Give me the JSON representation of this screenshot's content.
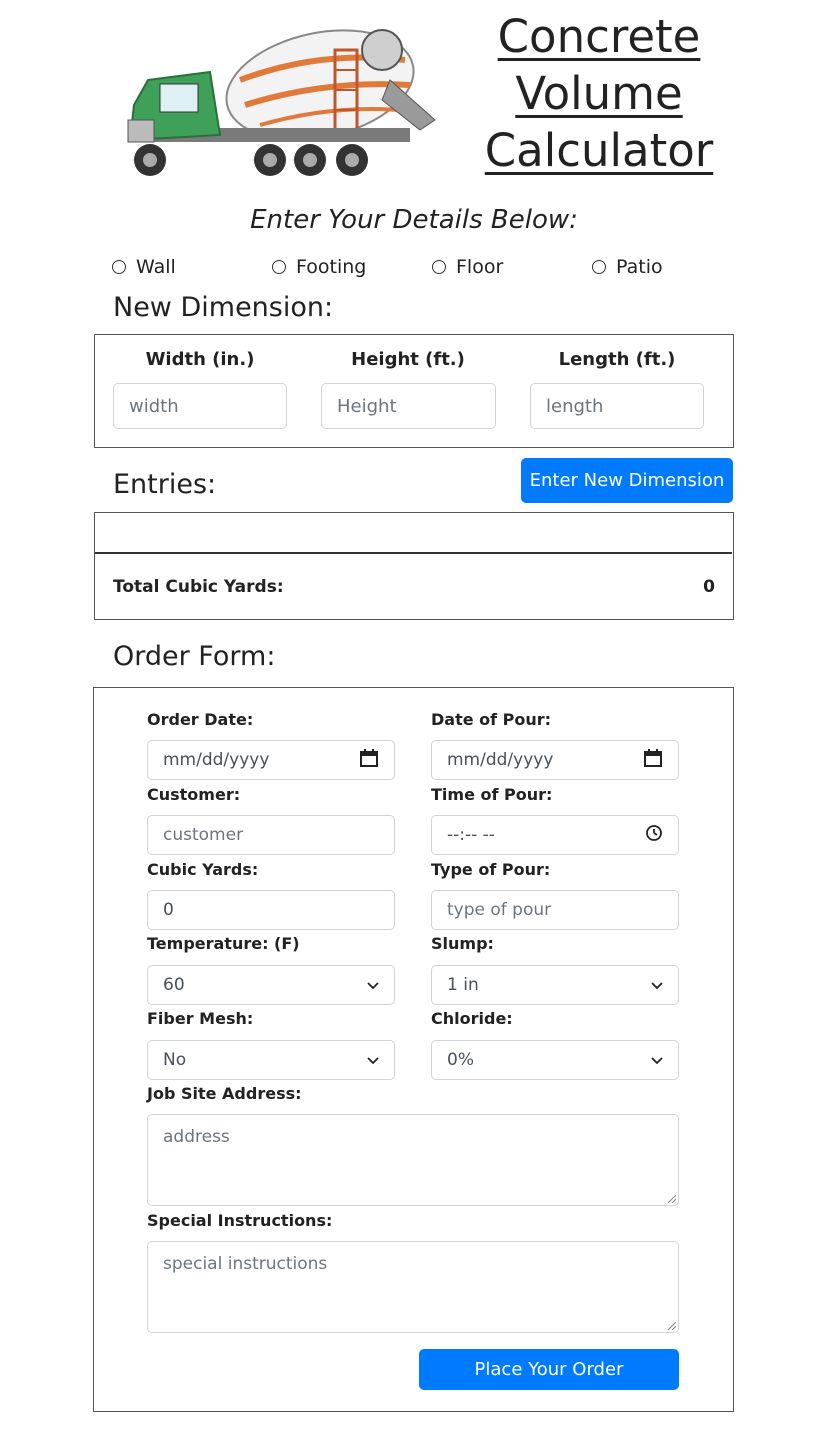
{
  "header": {
    "title_line1": "Concrete",
    "title_line2": "Volume",
    "title_line3": "Calculator",
    "subtitle": "Enter Your Details Below:"
  },
  "structure_types": [
    {
      "label": "Wall"
    },
    {
      "label": "Footing"
    },
    {
      "label": "Floor"
    },
    {
      "label": "Patio"
    }
  ],
  "new_dimension": {
    "heading": "New Dimension:",
    "width_label": "Width (in.)",
    "width_placeholder": "width",
    "height_label": "Height (ft.)",
    "height_placeholder": "Height",
    "length_label": "Length (ft.)",
    "length_placeholder": "length",
    "enter_button": "Enter New Dimension"
  },
  "entries": {
    "heading": "Entries:",
    "total_label": "Total Cubic Yards:",
    "total_value": "0"
  },
  "order_form": {
    "heading": "Order Form:",
    "order_date_label": "Order Date:",
    "order_date_placeholder": "mm/dd/yyyy",
    "date_of_pour_label": "Date of Pour:",
    "date_of_pour_placeholder": "mm/dd/yyyy",
    "customer_label": "Customer:",
    "customer_placeholder": "customer",
    "time_of_pour_label": "Time of Pour:",
    "time_of_pour_placeholder": "--:-- --",
    "cubic_yards_label": "Cubic Yards:",
    "cubic_yards_value": "0",
    "type_of_pour_label": "Type of Pour:",
    "type_of_pour_placeholder": "type of pour",
    "temperature_label": "Temperature: (F)",
    "temperature_value": "60",
    "slump_label": "Slump:",
    "slump_value": "1 in",
    "fiber_mesh_label": "Fiber Mesh:",
    "fiber_mesh_value": "No",
    "chloride_label": "Chloride:",
    "chloride_value": "0%",
    "address_label": "Job Site Address:",
    "address_placeholder": "address",
    "instructions_label": "Special Instructions:",
    "instructions_placeholder": "special instructions",
    "submit_button": "Place Your Order"
  },
  "colors": {
    "primary": "#007bff",
    "border": "#555555",
    "input_border": "#ced4da"
  }
}
